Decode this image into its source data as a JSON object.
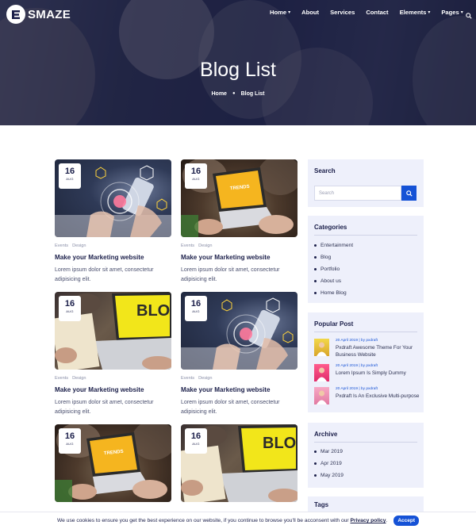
{
  "brand": {
    "name": "SMAZE"
  },
  "nav": {
    "items": [
      {
        "label": "Home",
        "dropdown": true
      },
      {
        "label": "About",
        "dropdown": false
      },
      {
        "label": "Services",
        "dropdown": false
      },
      {
        "label": "Contact",
        "dropdown": false
      },
      {
        "label": "Elements",
        "dropdown": true
      },
      {
        "label": "Pages",
        "dropdown": true
      }
    ],
    "search_icon": "search-icon"
  },
  "hero": {
    "title": "Blog List",
    "breadcrumb": [
      "Home",
      "Blog List"
    ]
  },
  "posts": [
    {
      "day": "16",
      "month": "AUG",
      "tags": [
        "Events",
        "Design"
      ],
      "title": "Make your Marketing website",
      "excerpt": "Lorem ipsum dolor sit amet, consectetur adipisicing elit.",
      "image": "tech"
    },
    {
      "day": "16",
      "month": "AUG",
      "tags": [
        "Events",
        "Design"
      ],
      "title": "Make your Marketing website",
      "excerpt": "Lorem ipsum dolor sit amet, consectetur adipisicing elit.",
      "image": "trends",
      "image_text": "TRENDS"
    },
    {
      "day": "16",
      "month": "AUG",
      "tags": [
        "Events",
        "Design"
      ],
      "title": "Make your Marketing website",
      "excerpt": "Lorem ipsum dolor sit amet, consectetur adipisicing elit.",
      "image": "blog",
      "image_text": "BLOG"
    },
    {
      "day": "16",
      "month": "AUG",
      "tags": [
        "Events",
        "Design"
      ],
      "title": "Make your Marketing website",
      "excerpt": "Lorem ipsum dolor sit amet, consectetur adipisicing elit.",
      "image": "tech"
    },
    {
      "day": "16",
      "month": "AUG",
      "image": "trends",
      "image_text": "TRENDS"
    },
    {
      "day": "16",
      "month": "AUG",
      "image": "blog",
      "image_text": "BLOG"
    }
  ],
  "sidebar": {
    "search": {
      "title": "Search",
      "placeholder": "Search"
    },
    "categories": {
      "title": "Categories",
      "items": [
        "Entertainment",
        "Blog",
        "Portfolio",
        "About us",
        "Home Blog"
      ]
    },
    "popular": {
      "title": "Popular Post",
      "items": [
        {
          "meta": "20 April 2019 | by pxdraft",
          "title": "Pxdraft Awesome Theme For Your Business Website"
        },
        {
          "meta": "20 April 2019 | by pxdraft",
          "title": "Lorem Ipsum Is Simply Dummy"
        },
        {
          "meta": "20 April 2019 | by pxdraft",
          "title": "Pxdraft Is An Exclusive Multi-purpose"
        }
      ]
    },
    "archive": {
      "title": "Archive",
      "items": [
        "Mar 2019",
        "Apr 2019",
        "May 2019"
      ]
    },
    "tags": {
      "title": "Tags"
    }
  },
  "cookie": {
    "message": "We use cookies to ensure you get the best experience on our website, if you continue to browse you'll be acconsent with our",
    "link": "Privacy policy",
    "accept": "Accept"
  },
  "colors": {
    "accent": "#1552d6",
    "navy": "#1b1f4a",
    "widget_bg": "#eef0fb"
  }
}
